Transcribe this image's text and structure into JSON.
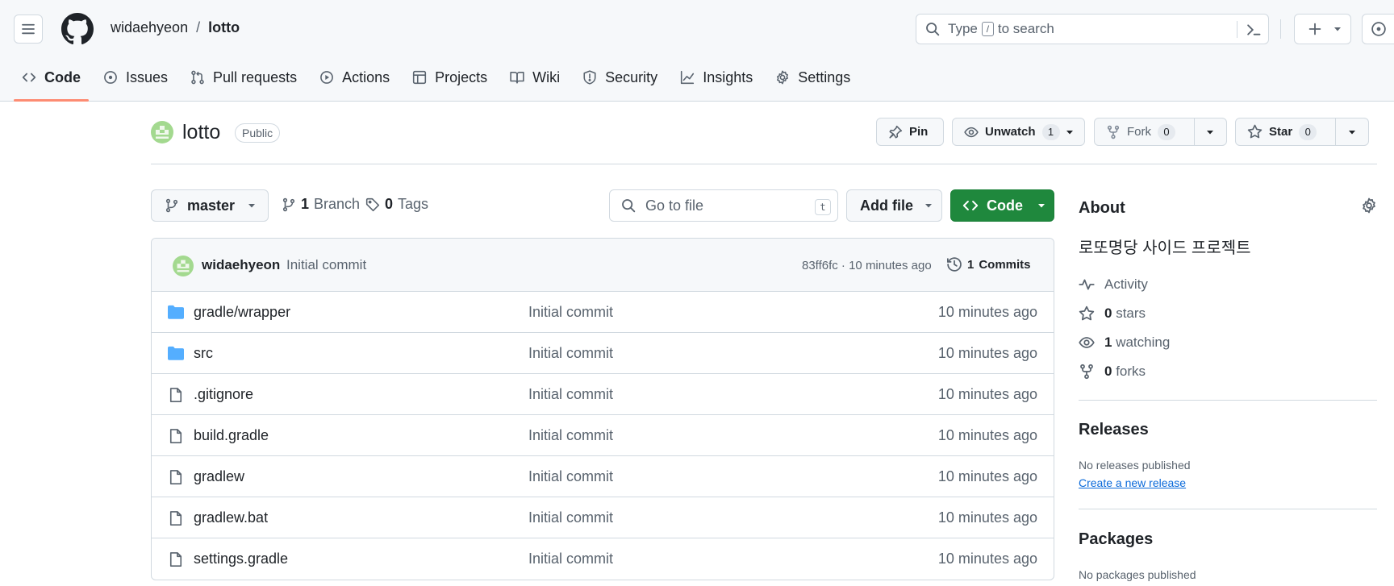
{
  "header": {
    "owner": "widaehyeon",
    "separator": "/",
    "repo": "lotto",
    "search": {
      "before": "Type",
      "key": "/",
      "after": "to search"
    }
  },
  "tabs": [
    {
      "label": "Code",
      "icon": "code-icon",
      "active": true
    },
    {
      "label": "Issues",
      "icon": "issue-icon"
    },
    {
      "label": "Pull requests",
      "icon": "pull-request-icon"
    },
    {
      "label": "Actions",
      "icon": "play-icon"
    },
    {
      "label": "Projects",
      "icon": "table-icon"
    },
    {
      "label": "Wiki",
      "icon": "book-icon"
    },
    {
      "label": "Security",
      "icon": "shield-icon"
    },
    {
      "label": "Insights",
      "icon": "graph-icon"
    },
    {
      "label": "Settings",
      "icon": "gear-icon"
    }
  ],
  "repo_title": {
    "name": "lotto",
    "visibility": "Public",
    "pin_label": "Pin",
    "watch_label": "Unwatch",
    "watch_count": "1",
    "fork_label": "Fork",
    "fork_count": "0",
    "star_label": "Star",
    "star_count": "0"
  },
  "file_nav": {
    "branch": "master",
    "branch_count": "1",
    "branch_label": "Branch",
    "tag_count": "0",
    "tag_label": "Tags",
    "goto_placeholder": "Go to file",
    "goto_key": "t",
    "add_file_label": "Add file",
    "code_label": "Code"
  },
  "latest_commit": {
    "author": "widaehyeon",
    "message": "Initial commit",
    "meta": "83ff6fc · 10 minutes ago",
    "commits_count": "1",
    "commits_label": "Commits"
  },
  "files": [
    {
      "name": "gradle/wrapper",
      "type": "folder",
      "message": "Initial commit",
      "age": "10 minutes ago"
    },
    {
      "name": "src",
      "type": "folder",
      "message": "Initial commit",
      "age": "10 minutes ago"
    },
    {
      "name": ".gitignore",
      "type": "file",
      "message": "Initial commit",
      "age": "10 minutes ago"
    },
    {
      "name": "build.gradle",
      "type": "file",
      "message": "Initial commit",
      "age": "10 minutes ago"
    },
    {
      "name": "gradlew",
      "type": "file",
      "message": "Initial commit",
      "age": "10 minutes ago"
    },
    {
      "name": "gradlew.bat",
      "type": "file",
      "message": "Initial commit",
      "age": "10 minutes ago"
    },
    {
      "name": "settings.gradle",
      "type": "file",
      "message": "Initial commit",
      "age": "10 minutes ago"
    }
  ],
  "about": {
    "title": "About",
    "description": "로또명당 사이드 프로젝트",
    "activity_label": "Activity",
    "stars_count": "0",
    "stars_label": "stars",
    "watching_count": "1",
    "watching_label": "watching",
    "forks_count": "0",
    "forks_label": "forks"
  },
  "releases": {
    "title": "Releases",
    "text": "No releases published",
    "link": "Create a new release"
  },
  "packages": {
    "title": "Packages",
    "text": "No packages published"
  },
  "colors": {
    "accent_underline": "#fd8c73",
    "code_button": "#1f883d",
    "link": "#0969da",
    "folder": "#54aeff"
  }
}
